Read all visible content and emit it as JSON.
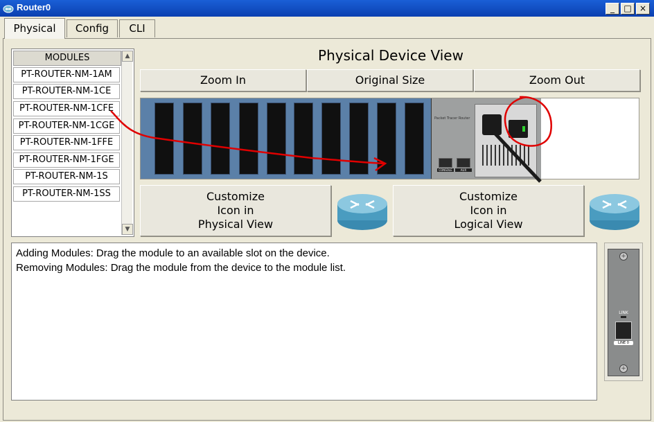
{
  "window": {
    "title": "Router0",
    "minimize": "_",
    "maximize": "□",
    "close": "×"
  },
  "tabs": [
    "Physical",
    "Config",
    "CLI"
  ],
  "modules": {
    "header": "MODULES",
    "items": [
      "PT-ROUTER-NM-1AM",
      "PT-ROUTER-NM-1CE",
      "PT-ROUTER-NM-1CFE",
      "PT-ROUTER-NM-1CGE",
      "PT-ROUTER-NM-1FFE",
      "PT-ROUTER-NM-1FGE",
      "PT-ROUTER-NM-1S",
      "PT-ROUTER-NM-1SS"
    ]
  },
  "physical_view": {
    "title": "Physical Device View",
    "zoom_in": "Zoom In",
    "original_size": "Original Size",
    "zoom_out": "Zoom Out",
    "device_label": "Packet Tracer Router",
    "console_label": "CONSOLE",
    "aux_label": "AUX"
  },
  "customize": {
    "physical": [
      "Customize",
      "Icon in",
      "Physical View"
    ],
    "logical": [
      "Customize",
      "Icon in",
      "Logical View"
    ]
  },
  "help": {
    "line1": "Adding Modules: Drag the module to an available slot on the device.",
    "line2": "Removing Modules: Drag the module from the device to the module list."
  },
  "module_preview": {
    "link_label": "LINK",
    "port_label": "LINE 0"
  },
  "colors": {
    "titlebar": "#0a3fb0",
    "chassis": "#5b80a8",
    "annotation": "#e00000",
    "router_icon": "#5aa8c8"
  }
}
